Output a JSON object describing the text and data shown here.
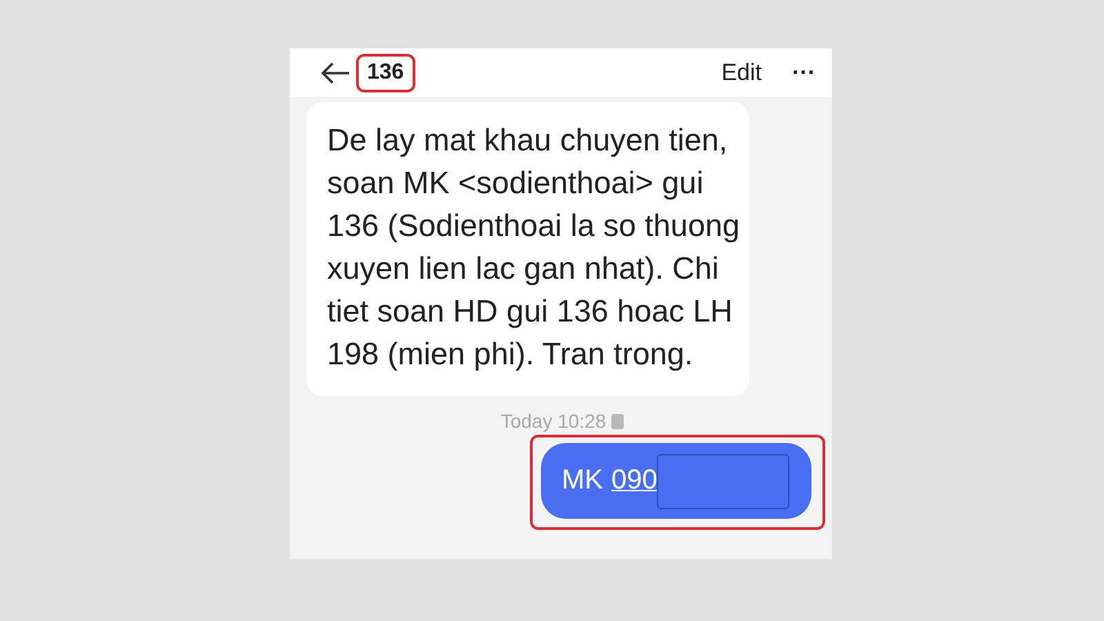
{
  "header": {
    "title": "136",
    "title_highlighted": true,
    "edit": "Edit",
    "more": "···"
  },
  "messages": [
    {
      "kind": "incoming",
      "text": "De lay mat khau chuyen tien, soan MK <sodienthoai> gui 136 (Sodienthoai la so thuong xuyen lien lac gan nhat). Chi tiet soan HD gui 136 hoac LH 198 (mien phi). Tran trong."
    },
    {
      "kind": "timestamp",
      "text": "Today 10:28"
    },
    {
      "kind": "outgoing",
      "prefix": "MK",
      "number": "090",
      "redacted": true,
      "highlighted": true
    }
  ]
}
